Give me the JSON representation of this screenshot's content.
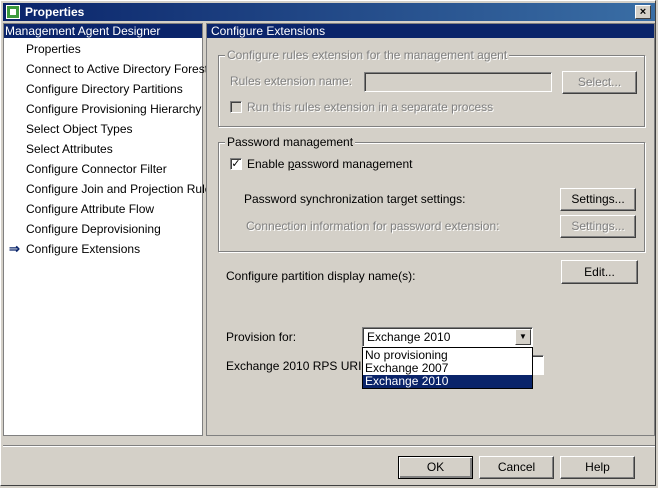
{
  "window": {
    "title": "Properties",
    "close_glyph": "×"
  },
  "sidebar": {
    "header": "Management Agent Designer",
    "current_marker": "⇒",
    "items": [
      {
        "label": "Properties"
      },
      {
        "label": "Connect to Active Directory Forest"
      },
      {
        "label": "Configure Directory Partitions"
      },
      {
        "label": "Configure Provisioning Hierarchy"
      },
      {
        "label": "Select Object Types"
      },
      {
        "label": "Select Attributes"
      },
      {
        "label": "Configure Connector Filter"
      },
      {
        "label": "Configure Join and Projection Rules"
      },
      {
        "label": "Configure Attribute Flow"
      },
      {
        "label": "Configure Deprovisioning"
      },
      {
        "label": "Configure Extensions"
      }
    ]
  },
  "main": {
    "header": "Configure Extensions",
    "rules_group": {
      "legend": "Configure rules extension for the management agent",
      "name_label": "Rules extension name:",
      "name_value": "",
      "select_button": "Select...",
      "separate_process_label": "Run this rules extension in a separate process",
      "separate_process_checked": false
    },
    "password_group": {
      "legend": "Password management",
      "enable_label_prefix": "Enable ",
      "enable_label_accel": "p",
      "enable_label_suffix": "assword management",
      "enable_checked": true,
      "sync_label": "Password synchronization target settings:",
      "sync_button": "Settings...",
      "connection_label": "Connection information for password extension:",
      "connection_button": "Settings..."
    },
    "partition": {
      "label": "Configure partition display name(s):",
      "button": "Edit..."
    },
    "provision": {
      "label": "Provision for:",
      "selected": "Exchange 2010",
      "options": [
        "No provisioning",
        "Exchange 2007",
        "Exchange 2010"
      ],
      "selected_index": 2
    },
    "rps": {
      "label": "Exchange 2010 RPS URI:",
      "value": ""
    }
  },
  "footer": {
    "ok": "OK",
    "cancel": "Cancel",
    "help": "Help"
  }
}
